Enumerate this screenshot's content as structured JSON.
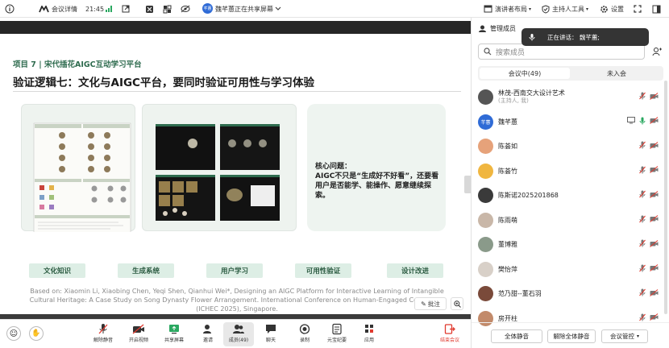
{
  "topbar": {
    "meeting_details": "会议详情",
    "time": "21:45",
    "sharer_badge": "芊蕙",
    "share_status": "魏芊蕙正在共享屏幕",
    "layout_label": "演讲者布局",
    "host_tools_label": "主持人工具",
    "settings_label": "设置"
  },
  "slide": {
    "subtitle": "项目 7 | 宋代插花AIGC互动学习平台",
    "title": "验证逻辑七：文化与AIGC平台，要同时验证可用性与学习体验",
    "core_question_heading": "核心问题：",
    "core_question_body": "AIGC不只是“生成好不好看”，还要看用户是否能学、能操作、愿意继续探索。",
    "pills": [
      "文化知识",
      "生成系统",
      "用户学习",
      "可用性验证",
      "设计改进"
    ],
    "citation": "Based on: Xiaomin Li, Xiaobing Chen, Yeqi Shen, Qianhui Wei*, Designing an AIGC Platform for Interactive Learning of Intangible Cultural Heritage: A Case Study on Song Dynasty Flower Arrangement. International Conference on Human-Engaged Computing (ICHEC 2025), Singapore.",
    "annotate_label": "批注"
  },
  "bottombar": {
    "buttons": [
      "解除静音",
      "开启视频",
      "共享屏幕",
      "邀请",
      "成员(49)",
      "聊天",
      "录制",
      "元宝纪要",
      "应用",
      "结束会议"
    ]
  },
  "panel": {
    "title": "管理成员",
    "search_placeholder": "搜索成员",
    "tab_in_meeting": "会议中(49)",
    "tab_not_joined": "未入会",
    "speaking_toast": "正在讲话：  魏芊蕙;",
    "members": [
      {
        "name": "林茂-西南交大设计艺术",
        "sub": "(主持人, 我)",
        "avatar": "#555555"
      },
      {
        "name": "魏芊蕙",
        "sub": "",
        "avatar": "#2f6bd6",
        "avatar_text": "芊蕙"
      },
      {
        "name": "陈荟如",
        "sub": "",
        "avatar": "#e6a27a"
      },
      {
        "name": "陈荟竹",
        "sub": "",
        "avatar": "#f0b640"
      },
      {
        "name": "陈斯诺2025201868",
        "sub": "",
        "avatar": "#3a3a3a"
      },
      {
        "name": "陈雨萌",
        "sub": "",
        "avatar": "#c9b7a8"
      },
      {
        "name": "董博雅",
        "sub": "",
        "avatar": "#8a9a8a"
      },
      {
        "name": "樊怡萍",
        "sub": "",
        "avatar": "#d8d0c8"
      },
      {
        "name": "范乃甜--董石羽",
        "sub": "",
        "avatar": "#7a4a3a"
      },
      {
        "name": "房开柱",
        "sub": "",
        "avatar": "#c28a6a"
      }
    ],
    "mute_all": "全体静音",
    "unmute_all": "解除全体静音",
    "meeting_control": "会议管控"
  }
}
